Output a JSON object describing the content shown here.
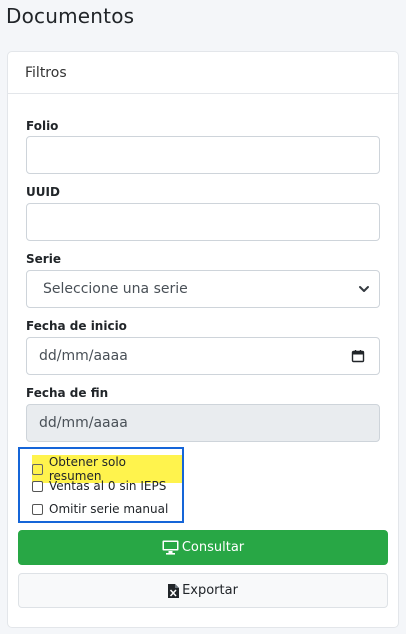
{
  "page": {
    "title": "Documentos"
  },
  "filters": {
    "header": "Filtros",
    "folio": {
      "label": "Folio",
      "value": ""
    },
    "uuid": {
      "label": "UUID",
      "value": ""
    },
    "serie": {
      "label": "Serie",
      "selected": "Seleccione una serie"
    },
    "fecha_inicio": {
      "label": "Fecha de inicio",
      "placeholder": "dd/mm/aaaa"
    },
    "fecha_fin": {
      "label": "Fecha de fin",
      "placeholder": "dd/mm/aaaa"
    },
    "checkboxes": [
      {
        "label": "Obtener solo resumen",
        "checked": false
      },
      {
        "label": "Ventas al 0 sin IEPS",
        "checked": false
      },
      {
        "label": "Omitir serie manual",
        "checked": false
      }
    ]
  },
  "actions": {
    "consultar_label": "Consultar",
    "exportar_label": "Exportar"
  },
  "colors": {
    "accent_green": "#28a745",
    "highlight_box": "#1565d8",
    "highlight_yellow": "#fff34d"
  },
  "icons": {
    "consultar": "monitor-icon",
    "exportar": "excel-file-icon",
    "select": "chevron-down-icon",
    "date": "calendar-icon"
  }
}
